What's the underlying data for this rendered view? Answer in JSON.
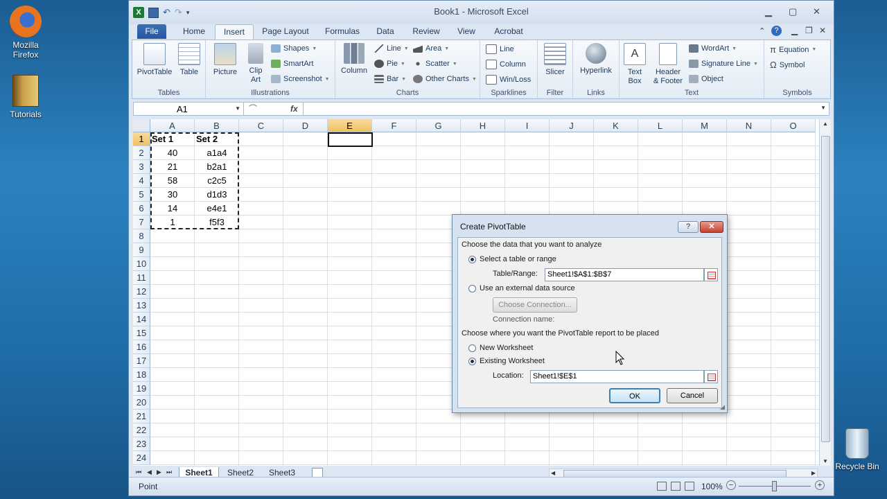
{
  "desktop": {
    "firefox_label": "Mozilla\nFirefox",
    "tutorials_label": "Tutorials",
    "recycle_label": "Recycle Bin"
  },
  "window": {
    "title": "Book1 - Microsoft Excel"
  },
  "tabs": [
    "File",
    "Home",
    "Insert",
    "Page Layout",
    "Formulas",
    "Data",
    "Review",
    "View",
    "Acrobat"
  ],
  "ribbon": {
    "tables": {
      "label": "Tables",
      "pivottable": "PivotTable",
      "table": "Table"
    },
    "illustrations": {
      "label": "Illustrations",
      "picture": "Picture",
      "clipart": "Clip\nArt",
      "shapes": "Shapes",
      "smartart": "SmartArt",
      "screenshot": "Screenshot"
    },
    "charts": {
      "label": "Charts",
      "column": "Column",
      "line": "Line",
      "pie": "Pie",
      "bar": "Bar",
      "area": "Area",
      "scatter": "Scatter",
      "other": "Other Charts"
    },
    "sparklines": {
      "label": "Sparklines",
      "line": "Line",
      "column": "Column",
      "winloss": "Win/Loss"
    },
    "filter": {
      "label": "Filter",
      "slicer": "Slicer"
    },
    "links": {
      "label": "Links",
      "hyperlink": "Hyperlink"
    },
    "text": {
      "label": "Text",
      "textbox": "Text\nBox",
      "header": "Header\n& Footer",
      "wordart": "WordArt",
      "signature": "Signature Line",
      "object": "Object"
    },
    "symbols": {
      "label": "Symbols",
      "equation": "Equation",
      "symbol": "Symbol"
    }
  },
  "formula": {
    "namebox": "A1",
    "fx": "fx",
    "value": ""
  },
  "grid": {
    "columns": [
      "A",
      "B",
      "C",
      "D",
      "E",
      "F",
      "G",
      "H",
      "I",
      "J",
      "K",
      "L",
      "M",
      "N",
      "O"
    ],
    "selected_column": "E",
    "rows": [
      "1",
      "2",
      "3",
      "4",
      "5",
      "6",
      "7",
      "8",
      "9",
      "10",
      "11",
      "12",
      "13",
      "14",
      "15",
      "16",
      "17",
      "18",
      "19",
      "20",
      "21",
      "22",
      "23",
      "24"
    ],
    "data": [
      [
        "Set 1",
        "Set 2"
      ],
      [
        "40",
        "a1a4"
      ],
      [
        "21",
        "b2a1"
      ],
      [
        "58",
        "c2c5"
      ],
      [
        "30",
        "d1d3"
      ],
      [
        "14",
        "e4e1"
      ],
      [
        "1",
        "f5f3"
      ]
    ]
  },
  "dialog": {
    "title": "Create PivotTable",
    "section1": "Choose the data that you want to analyze",
    "opt_range": "Select a table or range",
    "range_label": "Table/Range:",
    "range_value": "Sheet1!$A$1:$B$7",
    "opt_external": "Use an external data source",
    "choose_conn": "Choose Connection...",
    "conn_name": "Connection name:",
    "section2": "Choose where you want the PivotTable report to be placed",
    "opt_new": "New Worksheet",
    "opt_existing": "Existing Worksheet",
    "location_label": "Location:",
    "location_value": "Sheet1!$E$1",
    "ok": "OK",
    "cancel": "Cancel"
  },
  "sheets": [
    "Sheet1",
    "Sheet2",
    "Sheet3"
  ],
  "status": {
    "mode": "Point",
    "zoom": "100%"
  }
}
